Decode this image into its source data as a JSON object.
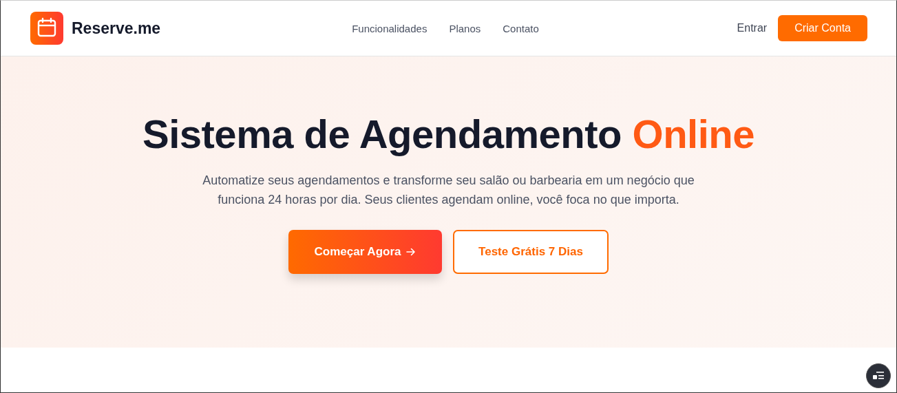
{
  "brand": {
    "name": "Reserve.me"
  },
  "nav": [
    {
      "label": "Funcionalidades"
    },
    {
      "label": "Planos"
    },
    {
      "label": "Contato"
    }
  ],
  "auth": {
    "login": "Entrar",
    "signup": "Criar Conta"
  },
  "hero": {
    "title": "Sistema de Agendamento",
    "title_highlight": "Online",
    "subtitle": "Automatize seus agendamentos e transforme seu salão ou barbearia em um negócio que funciona 24 horas por dia. Seus clientes agendam online, você foca no que importa.",
    "buttons": [
      {
        "kind": "primary",
        "label": "Começar Agora"
      },
      {
        "kind": "outline",
        "label": "Teste Grátis 7 Dias"
      }
    ]
  }
}
